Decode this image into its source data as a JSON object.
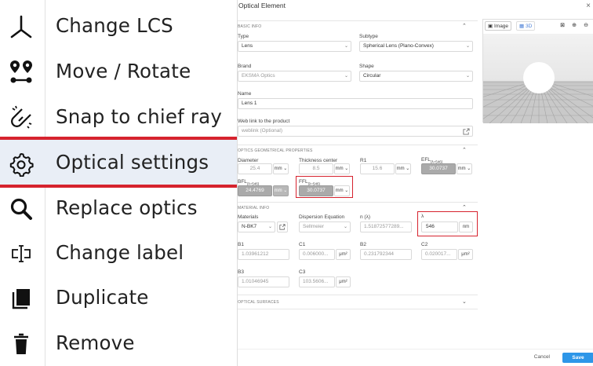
{
  "menu": {
    "items": [
      {
        "label": "Change LCS",
        "icon": "axes-icon"
      },
      {
        "label": "Move / Rotate",
        "icon": "move-pins-icon"
      },
      {
        "label": "Snap to chief ray",
        "icon": "snap-icon"
      },
      {
        "label": "Optical settings",
        "icon": "gear-icon"
      },
      {
        "label": "Replace optics",
        "icon": "search-icon"
      },
      {
        "label": "Change label",
        "icon": "label-cursor-icon"
      },
      {
        "label": "Duplicate",
        "icon": "duplicate-icon"
      },
      {
        "label": "Remove",
        "icon": "trash-icon"
      }
    ]
  },
  "panel": {
    "title": "Optical Element",
    "close": "×",
    "sections": {
      "basic": "BASIC INFO",
      "geom": "OPTICS GEOMETRICAL PROPERTIES",
      "material": "MATERIAL INFO",
      "surfaces": "OPTICAL SURFACES"
    },
    "basic": {
      "type_label": "Type",
      "type_value": "Lens",
      "subtype_label": "Subtype",
      "subtype_value": "Spherical Lens (Plano-Convex)",
      "brand_label": "Brand",
      "brand_value": "EKSMA Optics",
      "shape_label": "Shape",
      "shape_value": "Circular",
      "name_label": "Name",
      "name_value": "Lens 1",
      "web_label": "Web link to the product",
      "web_placeholder": "weblink (Optional)"
    },
    "geom": {
      "diameter_label": "Diameter",
      "diameter_value": "25.4",
      "diameter_unit": "mm",
      "thickness_label": "Thickness center",
      "thickness_value": "8.5",
      "thickness_unit": "mm",
      "r1_label": "R1",
      "r1_value": "15.6",
      "r1_unit": "mm",
      "efl_label": "EFL",
      "efl_sub": "(λ=546)",
      "efl_value": "30.0737",
      "efl_unit": "mm",
      "bfl_label": "BFL",
      "bfl_sub": "(λ=546)",
      "bfl_value": "24.4769",
      "bfl_unit": "mm",
      "ffl_label": "FFL",
      "ffl_sub": "(λ=546)",
      "ffl_value": "30.0737",
      "ffl_unit": "mm"
    },
    "material": {
      "materials_label": "Materials",
      "materials_value": "N-BK7",
      "dispersion_label": "Dispersion Equation",
      "dispersion_value": "Sellmeier",
      "n_label": "n (λ)",
      "n_value": "1.51872577289...",
      "lambda_label": "λ",
      "lambda_value": "546",
      "lambda_unit": "nm",
      "b1_label": "B1",
      "b1_value": "1.03961212",
      "c1_label": "C1",
      "c1_value": "0.006000...",
      "c1_unit": "μm²",
      "b2_label": "B2",
      "b2_value": "0.231792344",
      "c2_label": "C2",
      "c2_value": "0.020017...",
      "c2_unit": "μm²",
      "b3_label": "B3",
      "b3_value": "1.01046945",
      "c3_label": "C3",
      "c3_value": "103.5606...",
      "c3_unit": "μm²"
    },
    "view": {
      "image_label": "Image",
      "view3d_label": "3D"
    },
    "footer": {
      "cancel": "Cancel",
      "save": "Save"
    }
  }
}
